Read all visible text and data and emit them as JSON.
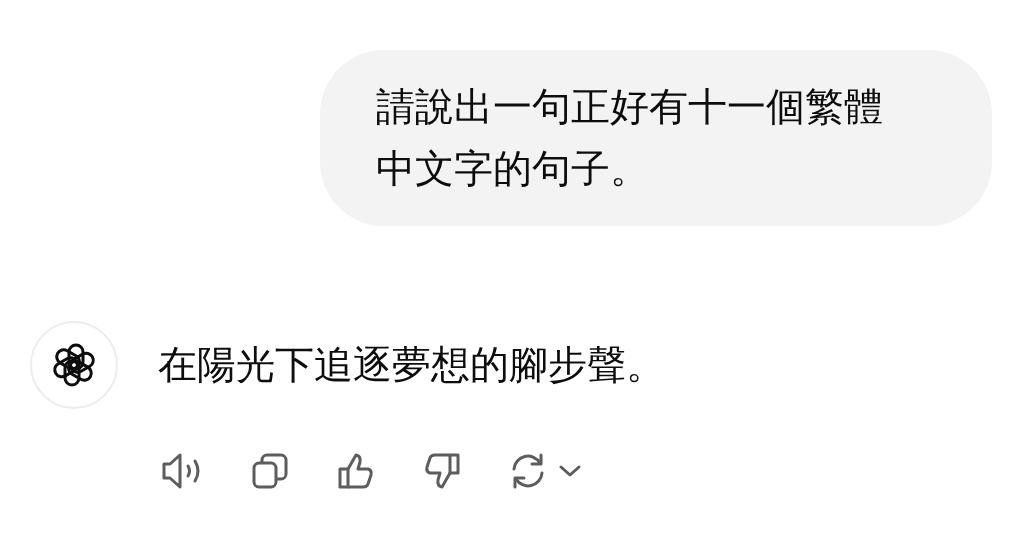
{
  "user_message": {
    "text": "請說出一句正好有十一個繁體中文字的句子。"
  },
  "assistant_message": {
    "text": "在陽光下追逐夢想的腳步聲。"
  }
}
